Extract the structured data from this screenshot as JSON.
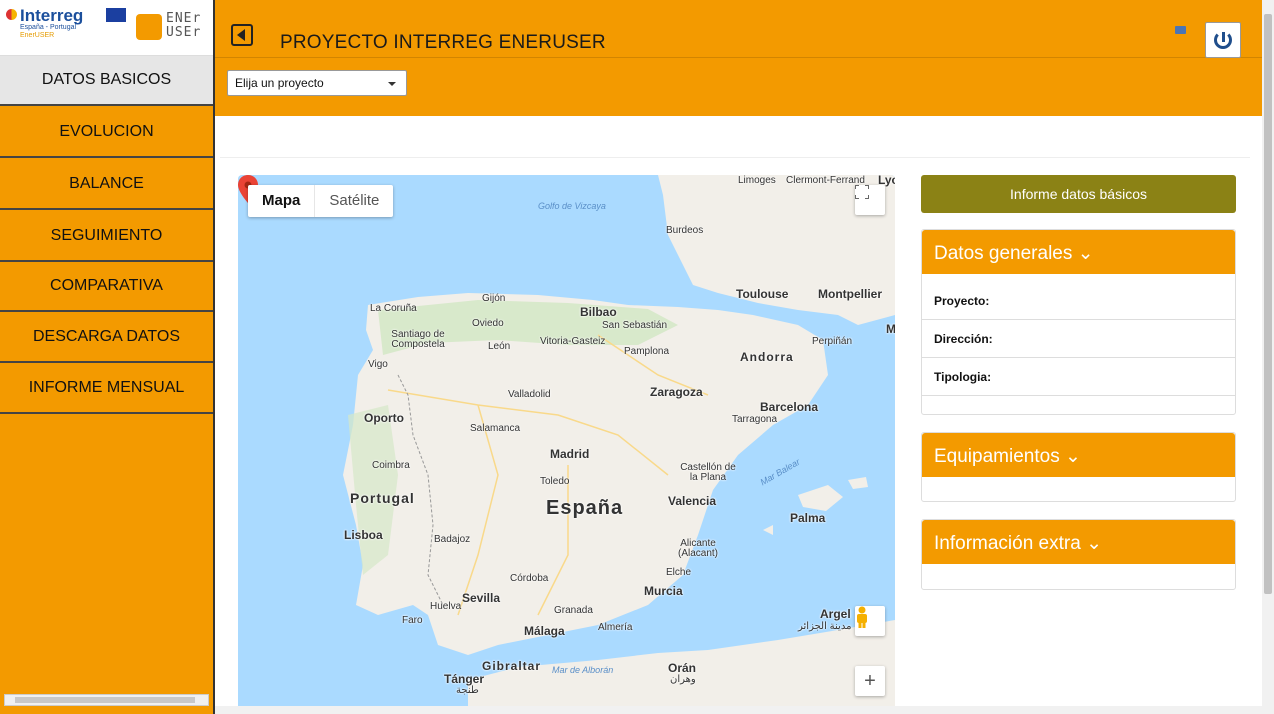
{
  "logo": {
    "interreg_word": "Interreg",
    "interreg_sub1": "España - Portugal",
    "interreg_sub2": "EnerUSER",
    "ener_top": "ENEr",
    "ener_bottom": "USEr"
  },
  "header": {
    "title": "PROYECTO INTERREG ENERUSER"
  },
  "sidebar": {
    "items": [
      {
        "label": "DATOS BASICOS",
        "active": true
      },
      {
        "label": "EVOLUCION"
      },
      {
        "label": "BALANCE"
      },
      {
        "label": "SEGUIMIENTO"
      },
      {
        "label": "COMPARATIVA"
      },
      {
        "label": "DESCARGA DATOS"
      },
      {
        "label": "INFORME MENSUAL"
      }
    ]
  },
  "project_select": {
    "value": "Elija un proyecto"
  },
  "map": {
    "tab_map": "Mapa",
    "tab_satellite": "Satélite",
    "zoom_in": "+",
    "labels": {
      "limoges": "Limoges",
      "clermont": "Clermont-Ferrand",
      "lyo": "Lyo",
      "golfo": "Golfo de Vizcaya",
      "burdeos": "Burdeos",
      "toulouse": "Toulouse",
      "montpellier": "Montpellier",
      "m": "M",
      "gijon": "Gijón",
      "lacoruna": "La Coruña",
      "oviedo": "Oviedo",
      "bilbao": "Bilbao",
      "sansebastian": "San Sebastián",
      "santiago": "Santiago de Compostela",
      "vitoria": "Vitoria-Gasteiz",
      "leon": "León",
      "pamplona": "Pamplona",
      "perpinan": "Perpiñán",
      "andorra": "Andorra",
      "vigo": "Vigo",
      "valladolid": "Valladolid",
      "zaragoza": "Zaragoza",
      "barcelona": "Barcelona",
      "tarragona": "Tarragona",
      "oporto": "Oporto",
      "salamanca": "Salamanca",
      "madrid": "Madrid",
      "coimbra": "Coimbra",
      "toledo": "Toledo",
      "castellon": "Castellón de la Plana",
      "marbalear": "Mar Balear",
      "portugal": "Portugal",
      "espana": "España",
      "valencia": "Valencia",
      "palma": "Palma",
      "lisboa": "Lisboa",
      "badajoz": "Badajoz",
      "alicante": "Alicante (Alacant)",
      "elche": "Elche",
      "cordoba": "Córdoba",
      "murcia": "Murcia",
      "sevilla": "Sevilla",
      "huelva": "Huelva",
      "granada": "Granada",
      "faro": "Faro",
      "almeria": "Almería",
      "malaga": "Málaga",
      "argel": "Argel",
      "argel_ar": "مدينة الجزائر",
      "gibraltar": "Gibraltar",
      "tanger": "Tánger",
      "tanger_ar": "طنجة",
      "maralboran": "Mar de Alborán",
      "oran": "Orán",
      "oran_ar": "وهران"
    }
  },
  "right_panel": {
    "report_button": "Informe datos básicos",
    "datos_generales": {
      "title": "Datos generales ⌄",
      "rows": [
        "Proyecto:",
        "Dirección:",
        "Tipologia:"
      ]
    },
    "equipamientos": {
      "title": "Equipamientos ⌄"
    },
    "informacion_extra": {
      "title": "Información extra ⌄"
    }
  },
  "colors": {
    "accent": "#f39a00",
    "report_button": "#8b8215",
    "sea": "#aadaff",
    "land": "#f2efe9"
  },
  "icons": {
    "back": "back-arrow-icon",
    "mail": "mail-icon",
    "power": "power-icon",
    "fullscreen": "fullscreen-icon",
    "pegman": "pegman-icon",
    "pin": "map-pin-icon"
  }
}
